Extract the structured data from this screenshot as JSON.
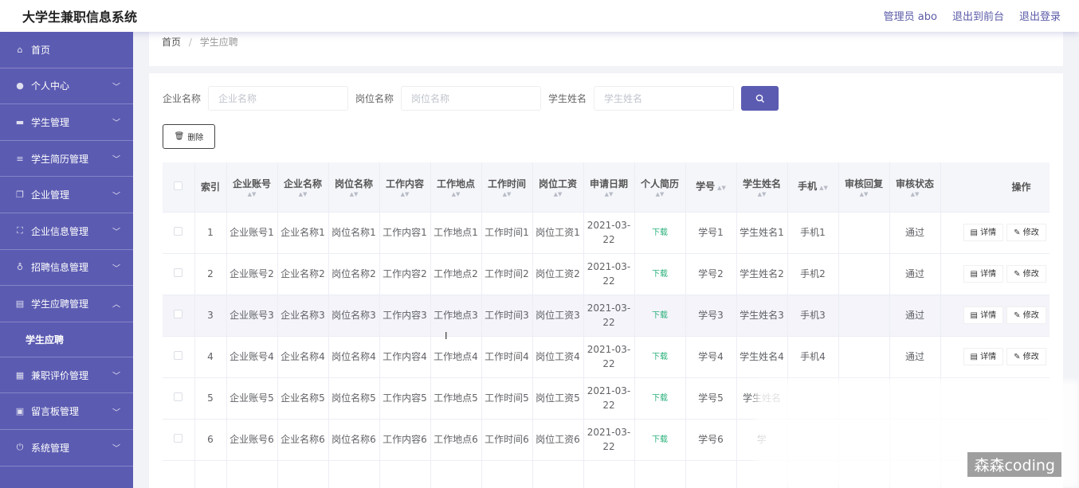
{
  "app": {
    "title": "大学生兼职信息系统"
  },
  "header": {
    "admin_label": "管理员 abo",
    "to_front": "退出到前台",
    "logout": "退出登录"
  },
  "sidebar": {
    "items": [
      {
        "label": "首页",
        "icon": "home-icon",
        "glyph": "⌂",
        "expandable": false
      },
      {
        "label": "个人中心",
        "icon": "user-icon",
        "glyph": "●",
        "expandable": true
      },
      {
        "label": "学生管理",
        "icon": "chat-icon",
        "glyph": "▬",
        "expandable": true
      },
      {
        "label": "学生简历管理",
        "icon": "list-icon",
        "glyph": "≡",
        "expandable": true
      },
      {
        "label": "企业管理",
        "icon": "copy-icon",
        "glyph": "❐",
        "expandable": true
      },
      {
        "label": "企业信息管理",
        "icon": "fullscreen-icon",
        "glyph": "⛶",
        "expandable": true
      },
      {
        "label": "招聘信息管理",
        "icon": "mic-icon",
        "glyph": "♁",
        "expandable": true
      },
      {
        "label": "学生应聘管理",
        "icon": "clipboard-icon",
        "glyph": "▤",
        "expandable": true,
        "open": true
      },
      {
        "label": "兼职评价管理",
        "icon": "grid-icon",
        "glyph": "▦",
        "expandable": true
      },
      {
        "label": "留言板管理",
        "icon": "calendar-icon",
        "glyph": "▣",
        "expandable": true
      },
      {
        "label": "系统管理",
        "icon": "power-icon",
        "glyph": "⏻",
        "expandable": true
      }
    ],
    "submenu_label": "学生应聘"
  },
  "breadcrumb": {
    "home": "首页",
    "separator": "/",
    "current": "学生应聘"
  },
  "search": {
    "company_label": "企业名称",
    "company_placeholder": "企业名称",
    "position_label": "岗位名称",
    "position_placeholder": "岗位名称",
    "student_label": "学生姓名",
    "student_placeholder": "学生姓名"
  },
  "toolbar": {
    "delete_label": "删除"
  },
  "table": {
    "headers": {
      "index": "索引",
      "account": "企业账号",
      "company": "企业名称",
      "position": "岗位名称",
      "content": "工作内容",
      "place": "工作地点",
      "time": "工作时间",
      "salary": "岗位工资",
      "date": "申请日期",
      "resume": "个人简历",
      "student_no": "学号",
      "student_name": "学生姓名",
      "phone": "手机",
      "reply": "审核回复",
      "status": "审核状态",
      "ops": "操作"
    },
    "rows": [
      {
        "index": "1",
        "account": "企业账号1",
        "company": "企业名称1",
        "position": "岗位名称1",
        "content": "工作内容1",
        "place": "工作地点1",
        "time": "工作时间1",
        "salary": "岗位工资1",
        "date": "2021-03-22",
        "resume": "下载",
        "student_no": "学号1",
        "student_name": "学生姓名1",
        "phone": "手机1",
        "reply": "",
        "status": "通过"
      },
      {
        "index": "2",
        "account": "企业账号2",
        "company": "企业名称2",
        "position": "岗位名称2",
        "content": "工作内容2",
        "place": "工作地点2",
        "time": "工作时间2",
        "salary": "岗位工资2",
        "date": "2021-03-22",
        "resume": "下载",
        "student_no": "学号2",
        "student_name": "学生姓名2",
        "phone": "手机2",
        "reply": "",
        "status": "通过"
      },
      {
        "index": "3",
        "account": "企业账号3",
        "company": "企业名称3",
        "position": "岗位名称3",
        "content": "工作内容3",
        "place": "工作地点3",
        "time": "工作时间3",
        "salary": "岗位工资3",
        "date": "2021-03-22",
        "resume": "下载",
        "student_no": "学号3",
        "student_name": "学生姓名3",
        "phone": "手机3",
        "reply": "",
        "status": "通过"
      },
      {
        "index": "4",
        "account": "企业账号4",
        "company": "企业名称4",
        "position": "岗位名称4",
        "content": "工作内容4",
        "place": "工作地点4",
        "time": "工作时间4",
        "salary": "岗位工资4",
        "date": "2021-03-22",
        "resume": "下载",
        "student_no": "学号4",
        "student_name": "学生姓名4",
        "phone": "手机4",
        "reply": "",
        "status": "通过"
      },
      {
        "index": "5",
        "account": "企业账号5",
        "company": "企业名称5",
        "position": "岗位名称5",
        "content": "工作内容5",
        "place": "工作地点5",
        "time": "工作时间5",
        "salary": "岗位工资5",
        "date": "2021-03-22",
        "resume": "下载",
        "student_no": "学号5",
        "student_name": "学生姓名",
        "phone": "",
        "reply": "",
        "status": ""
      },
      {
        "index": "6",
        "account": "企业账号6",
        "company": "企业名称6",
        "position": "岗位名称6",
        "content": "工作内容6",
        "place": "工作地点6",
        "time": "工作时间6",
        "salary": "岗位工资6",
        "date": "2021-03-22",
        "resume": "下载",
        "student_no": "学号6",
        "student_name": "学",
        "phone": "",
        "reply": "",
        "status": ""
      }
    ],
    "detail_label": "详情",
    "edit_label": "修改"
  },
  "watermark": "森森coding",
  "colors": {
    "primary": "#5b5bb2",
    "download": "#2ab07b"
  }
}
